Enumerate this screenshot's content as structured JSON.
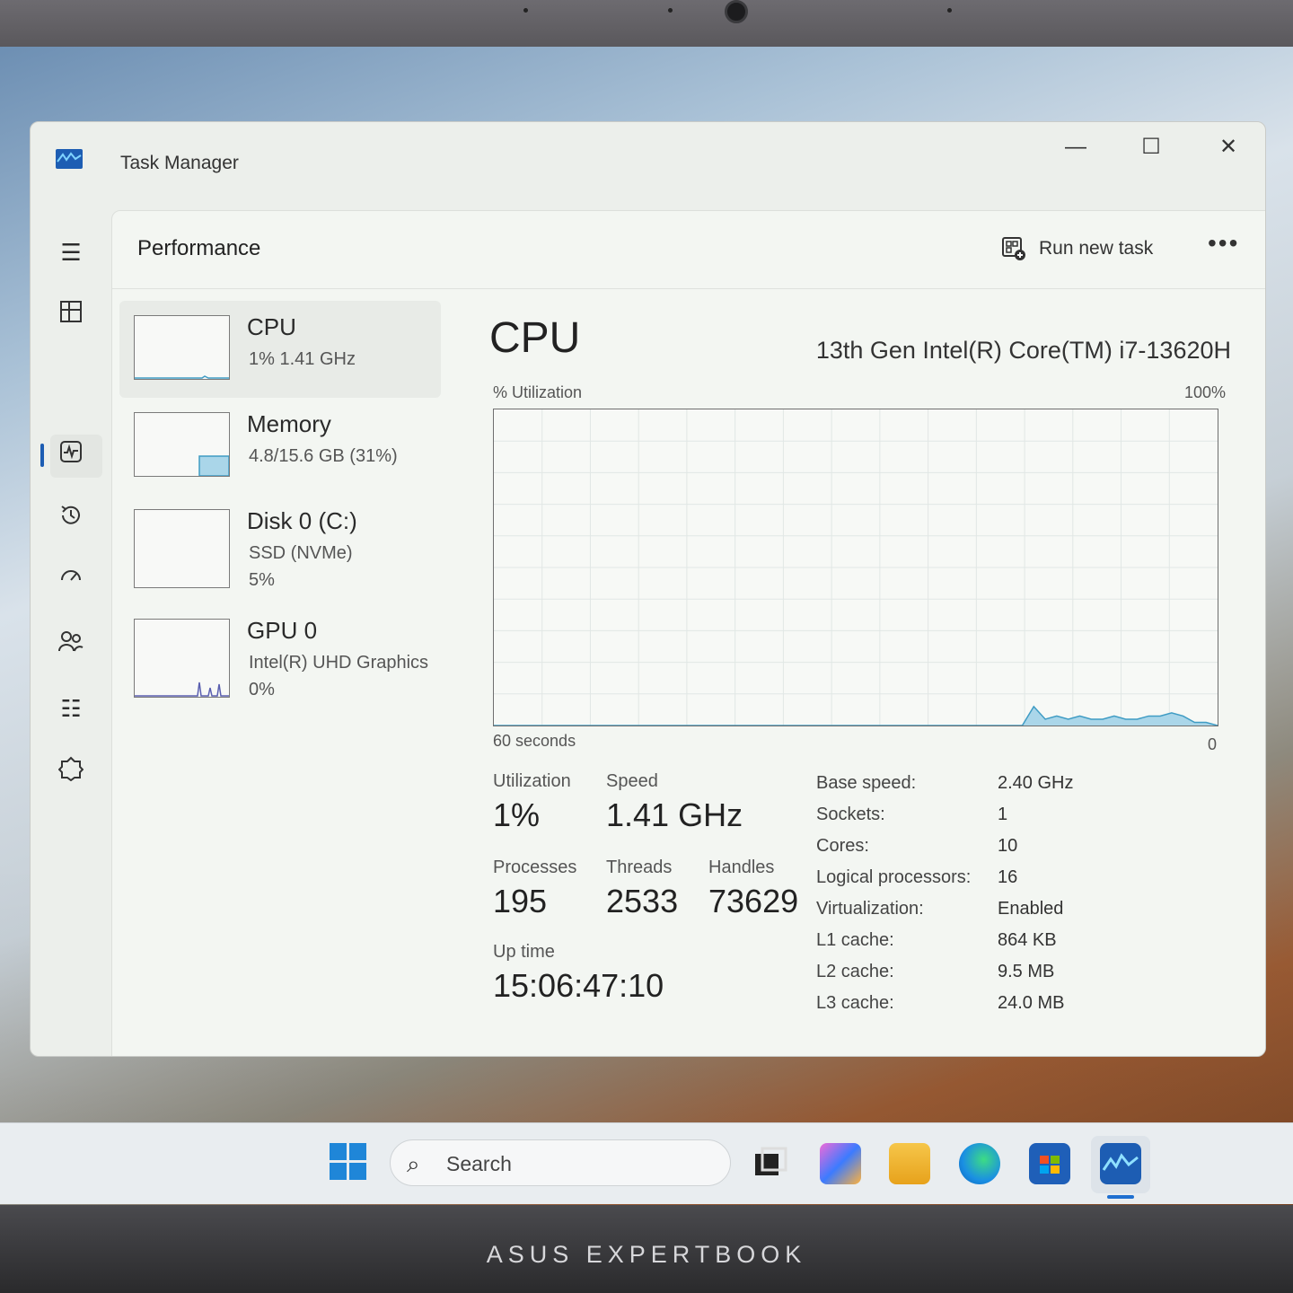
{
  "window": {
    "title": "Task Manager",
    "minimize": "—",
    "maximize": "☐",
    "close": "✕"
  },
  "header": {
    "page_title": "Performance",
    "run_new_task": "Run new task",
    "more": "•••"
  },
  "sidebar": {
    "icons": [
      "menu-icon",
      "processes-icon",
      "performance-icon",
      "app-history-icon",
      "startup-apps-icon",
      "users-icon",
      "details-icon",
      "services-icon",
      "settings-icon"
    ]
  },
  "perf_list": [
    {
      "name": "CPU",
      "line1": "1%  1.41 GHz",
      "line2": ""
    },
    {
      "name": "Memory",
      "line1": "4.8/15.6 GB (31%)",
      "line2": ""
    },
    {
      "name": "Disk 0 (C:)",
      "line1": "SSD (NVMe)",
      "line2": "5%"
    },
    {
      "name": "GPU 0",
      "line1": "Intel(R) UHD Graphics",
      "line2": "0%"
    }
  ],
  "detail": {
    "title": "CPU",
    "model": "13th Gen Intel(R) Core(TM) i7-13620H",
    "y_label": "% Utilization",
    "y_max": "100%",
    "x_left": "60 seconds",
    "x_right": "0",
    "utilization_label": "Utilization",
    "utilization": "1%",
    "speed_label": "Speed",
    "speed": "1.41 GHz",
    "processes_label": "Processes",
    "processes": "195",
    "threads_label": "Threads",
    "threads": "2533",
    "handles_label": "Handles",
    "handles": "73629",
    "uptime_label": "Up time",
    "uptime": "15:06:47:10",
    "specs": [
      {
        "key": "Base speed:",
        "value": "2.40 GHz"
      },
      {
        "key": "Sockets:",
        "value": "1"
      },
      {
        "key": "Cores:",
        "value": "10"
      },
      {
        "key": "Logical processors:",
        "value": "16"
      },
      {
        "key": "Virtualization:",
        "value": "Enabled"
      },
      {
        "key": "L1 cache:",
        "value": "864 KB"
      },
      {
        "key": "L2 cache:",
        "value": "9.5 MB"
      },
      {
        "key": "L3 cache:",
        "value": "24.0 MB"
      }
    ],
    "utilization_series": [
      0,
      0,
      0,
      0,
      0,
      0,
      0,
      0,
      0,
      0,
      0,
      0,
      0,
      0,
      0,
      0,
      0,
      0,
      0,
      0,
      0,
      0,
      0,
      0,
      0,
      0,
      0,
      0,
      0,
      0,
      0,
      0,
      0,
      0,
      0,
      0,
      0,
      0,
      0,
      0,
      0,
      0,
      0,
      0,
      0,
      0,
      0,
      6,
      2,
      3,
      2,
      3,
      2,
      2,
      3,
      2,
      2,
      3,
      3,
      4,
      3,
      1,
      1,
      0
    ]
  },
  "taskbar": {
    "search_placeholder": "Search",
    "apps": [
      "task-view-icon",
      "m365-copilot-icon",
      "file-explorer-icon",
      "edge-icon",
      "microsoft-store-icon",
      "task-manager-icon"
    ]
  },
  "device": {
    "brand": "ASUS EXPERTBOOK"
  },
  "colors": {
    "accent": "#1d5db3",
    "graph_line": "#3f9cc4",
    "graph_fill": "#aad6e9"
  }
}
